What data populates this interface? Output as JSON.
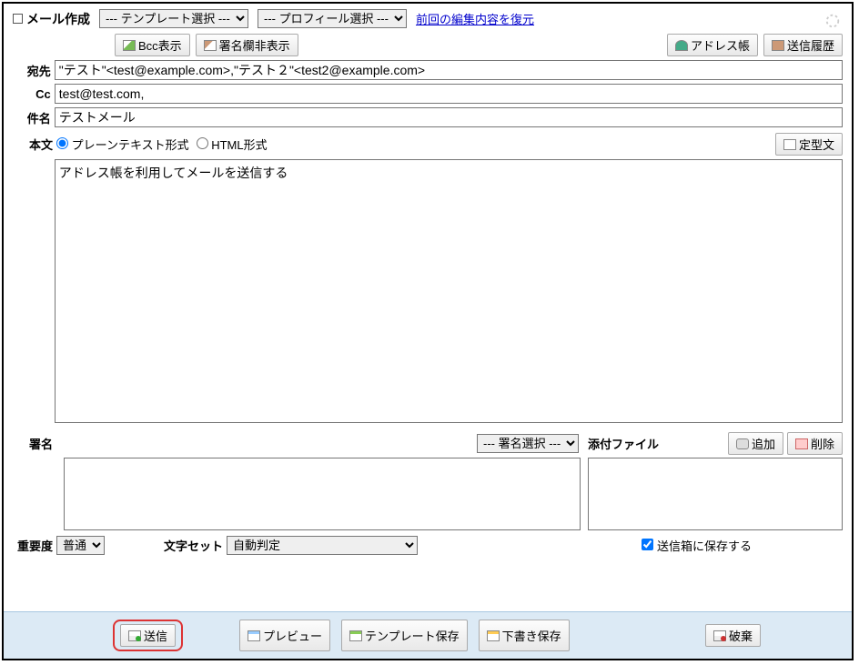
{
  "header": {
    "title": "メール作成",
    "templateSelectLabel": "--- テンプレート選択 ---",
    "profileSelectLabel": "--- プロフィール選択 ---",
    "restoreLink": "前回の編集内容を復元"
  },
  "topButtons": {
    "bccShow": "Bcc表示",
    "hideSignature": "署名欄非表示",
    "addressBook": "アドレス帳",
    "sendHistory": "送信履歴"
  },
  "fields": {
    "toLabel": "宛先",
    "toValue": "\"テスト\"<test@example.com>,\"テスト２\"<test2@example.com>",
    "ccLabel": "Cc",
    "ccValue": "test@test.com,",
    "subjectLabel": "件名",
    "subjectValue": "テストメール",
    "bodyLabel": "本文",
    "plainText": "プレーンテキスト形式",
    "htmlFormat": "HTML形式",
    "fixedPhrase": "定型文",
    "bodyText": "アドレス帳を利用してメールを送信する"
  },
  "signature": {
    "label": "署名",
    "selectLabel": "--- 署名選択 ---",
    "attachLabel": "添付ファイル",
    "addBtn": "追加",
    "deleteBtn": "削除"
  },
  "bottom": {
    "priorityLabel": "重要度",
    "priorityValue": "普通",
    "charsetLabel": "文字セット",
    "charsetValue": "自動判定",
    "saveToSent": "送信箱に保存する"
  },
  "footer": {
    "send": "送信",
    "preview": "プレビュー",
    "saveTemplate": "テンプレート保存",
    "saveDraft": "下書き保存",
    "discard": "破棄"
  }
}
